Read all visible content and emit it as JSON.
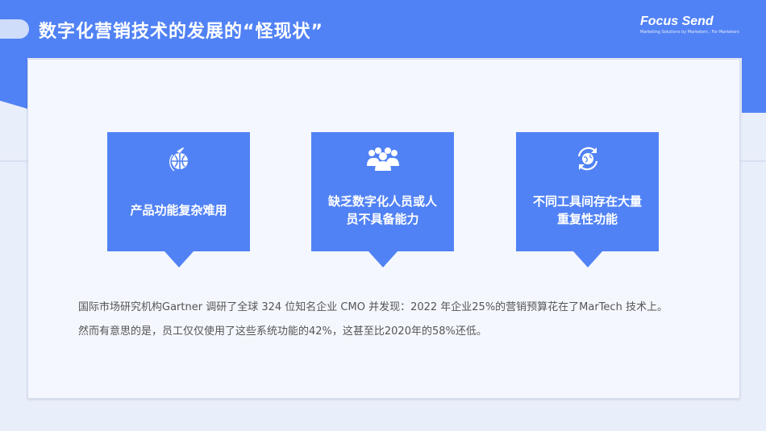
{
  "header": {
    "title": "数字化营销技术的发展的“怪现状”",
    "logo_name": "Focus Send",
    "logo_tagline": "Marketing Solutions by Marketers , For Marketers"
  },
  "colors": {
    "primary": "#5182f5",
    "card": "#f4f7fe",
    "background": "#e9eefb"
  },
  "boxes": [
    {
      "icon": "globe-plane-icon",
      "label": "产品功能复杂难用"
    },
    {
      "icon": "people-group-icon",
      "label": "缺乏数字化人员或人员不具备能力"
    },
    {
      "icon": "sync-globe-icon",
      "label": "不同工具间存在大量重复性功能"
    }
  ],
  "body": {
    "paragraph1": "国际市场研究机构Gartner 调研了全球 324 位知名企业 CMO 并发现：2022 年企业25%的营销预算花在了MarTech 技术上。",
    "paragraph2": "然而有意思的是，员工仅仅使用了这些系统功能的42%，这甚至比2020年的58%还低。"
  }
}
